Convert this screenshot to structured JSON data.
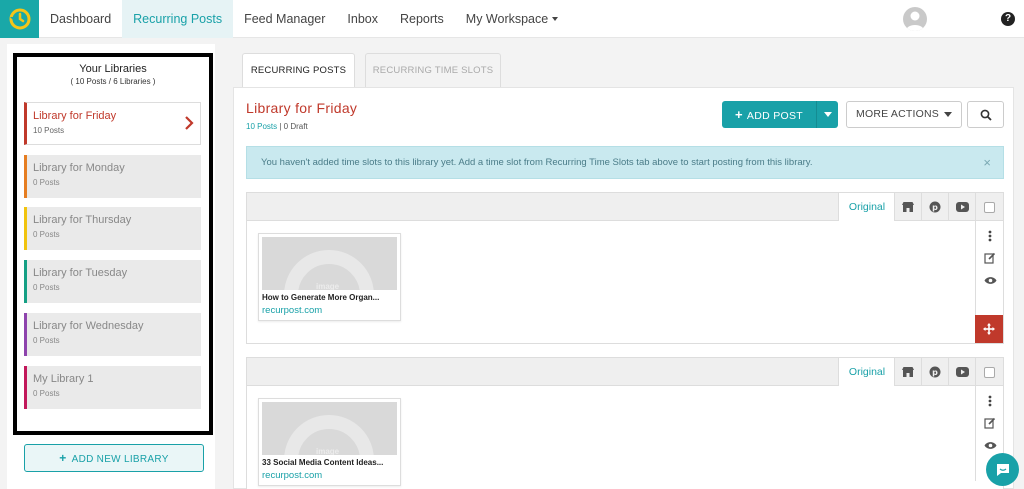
{
  "nav": {
    "items": [
      "Dashboard",
      "Recurring Posts",
      "Feed Manager",
      "Inbox",
      "Reports"
    ],
    "workspace": "My Workspace",
    "help": "?"
  },
  "sidebar": {
    "title": "Your Libraries",
    "subtitle": "( 10 Posts / 6 Libraries )",
    "libraries": [
      {
        "name": "Library for Friday",
        "count": "10 Posts",
        "color": "#c0392b"
      },
      {
        "name": "Library for Monday",
        "count": "0 Posts",
        "color": "#e67e22"
      },
      {
        "name": "Library for Thursday",
        "count": "0 Posts",
        "color": "#f1c40f"
      },
      {
        "name": "Library for Tuesday",
        "count": "0 Posts",
        "color": "#16a085"
      },
      {
        "name": "Library for Wednesday",
        "count": "0 Posts",
        "color": "#8e44ad"
      },
      {
        "name": "My Library 1",
        "count": "0 Posts",
        "color": "#c2185b"
      }
    ],
    "add_button": "ADD NEW LIBRARY"
  },
  "tabs": [
    "RECURRING POSTS",
    "RECURRING TIME SLOTS"
  ],
  "main": {
    "title": "Library for Friday",
    "posts_count": "10 Posts",
    "draft_count": "0 Draft",
    "add_post": "ADD POST",
    "more_actions": "MORE ACTIONS",
    "alert": "You haven't added time slots to this library yet. Add a time slot from Recurring Time Slots tab above to start posting from this library.",
    "close": "×"
  },
  "posts": [
    {
      "tab": "Original",
      "title": "How to Generate More Organ...",
      "source": "recurpost.com",
      "placeholder": "image"
    },
    {
      "tab": "Original",
      "title": "33 Social Media Content Ideas...",
      "source": "recurpost.com",
      "placeholder": "image"
    }
  ],
  "colors": {
    "accent": "#19a1a8",
    "brand_red": "#c0392b"
  }
}
